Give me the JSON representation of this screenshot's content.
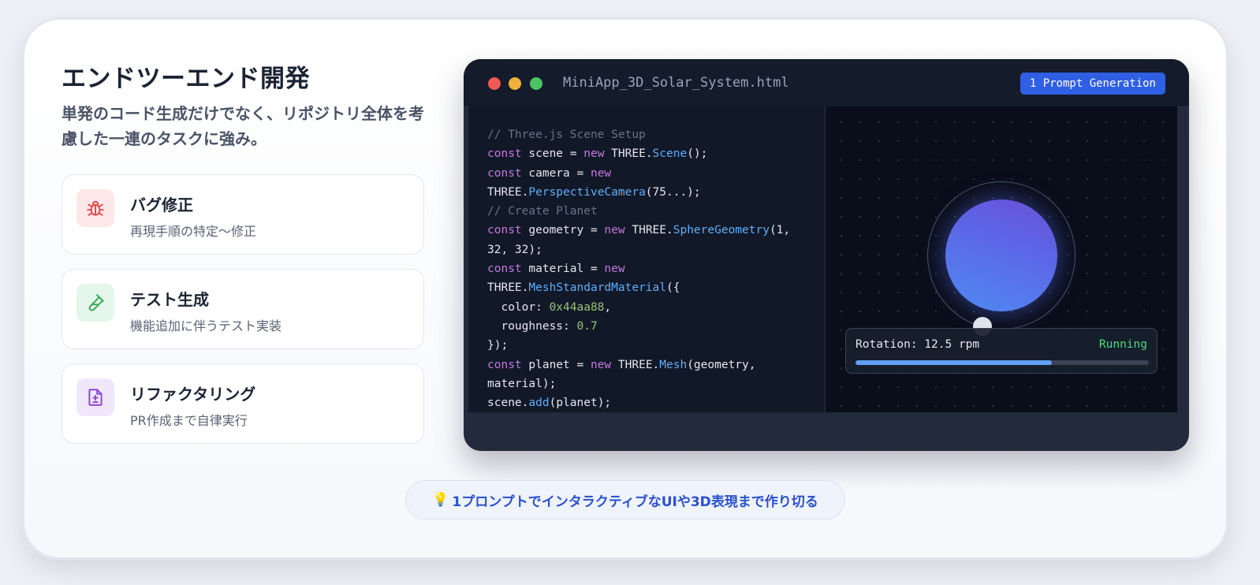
{
  "header": {
    "title": "エンドツーエンド開発",
    "subtitle": "単発のコード生成だけでなく、リポジトリ全体を考慮した一連のタスクに強み。"
  },
  "features": [
    {
      "title": "バグ修正",
      "desc": "再現手順の特定〜修正",
      "icon": "bug-icon",
      "color": "#e5484d",
      "bg": "#fde8e8"
    },
    {
      "title": "テスト生成",
      "desc": "機能追加に伴うテスト実装",
      "icon": "test-tube-icon",
      "color": "#3aa757",
      "bg": "#e5f6ea"
    },
    {
      "title": "リファクタリング",
      "desc": "PR作成まで自律実行",
      "icon": "file-diff-icon",
      "color": "#8b46d6",
      "bg": "#f0e7fb"
    }
  ],
  "window": {
    "filename": "MiniApp_3D_Solar_System.html",
    "badge": "1 Prompt Generation",
    "traffic_colors": [
      "#ef5a54",
      "#f0b13b",
      "#4cc463"
    ],
    "code_lines": [
      [
        {
          "t": "// Three.js Scene Setup",
          "c": "c"
        }
      ],
      [
        {
          "t": "const",
          "c": "k"
        },
        {
          "t": " scene = "
        },
        {
          "t": "new",
          "c": "k"
        },
        {
          "t": " THREE."
        },
        {
          "t": "Scene",
          "c": "f"
        },
        {
          "t": "();"
        }
      ],
      [
        {
          "t": "const",
          "c": "k"
        },
        {
          "t": " camera = "
        },
        {
          "t": "new",
          "c": "k"
        }
      ],
      [
        {
          "t": "THREE."
        },
        {
          "t": "PerspectiveCamera",
          "c": "f"
        },
        {
          "t": "(75...);"
        }
      ],
      [
        {
          "t": "// Create Planet",
          "c": "c"
        }
      ],
      [
        {
          "t": "const",
          "c": "k"
        },
        {
          "t": " geometry = "
        },
        {
          "t": "new",
          "c": "k"
        },
        {
          "t": " THREE."
        },
        {
          "t": "SphereGeometry",
          "c": "f"
        },
        {
          "t": "(1,"
        }
      ],
      [
        {
          "t": "32, 32);"
        }
      ],
      [
        {
          "t": "const",
          "c": "k"
        },
        {
          "t": " material = "
        },
        {
          "t": "new",
          "c": "k"
        }
      ],
      [
        {
          "t": "THREE."
        },
        {
          "t": "MeshStandardMaterial",
          "c": "f"
        },
        {
          "t": "({"
        }
      ],
      [
        {
          "t": "  color: "
        },
        {
          "t": "0x44aa88",
          "c": "n"
        },
        {
          "t": ","
        }
      ],
      [
        {
          "t": "  roughness: "
        },
        {
          "t": "0.7",
          "c": "n"
        }
      ],
      [
        {
          "t": "});"
        }
      ],
      [
        {
          "t": "const",
          "c": "k"
        },
        {
          "t": " planet = "
        },
        {
          "t": "new",
          "c": "k"
        },
        {
          "t": " THREE."
        },
        {
          "t": "Mesh",
          "c": "f"
        },
        {
          "t": "(geometry,"
        }
      ],
      [
        {
          "t": "material);"
        }
      ],
      [
        {
          "t": "scene."
        },
        {
          "t": "add",
          "c": "f"
        },
        {
          "t": "(planet);"
        }
      ]
    ],
    "preview": {
      "rotation_label": "Rotation: 12.5 rpm",
      "status": "Running",
      "progress": 0.67
    }
  },
  "tip": {
    "icon": "lightbulb-icon",
    "text": "1プロンプトでインタラクティブなUIや3D表現まで作り切る"
  }
}
